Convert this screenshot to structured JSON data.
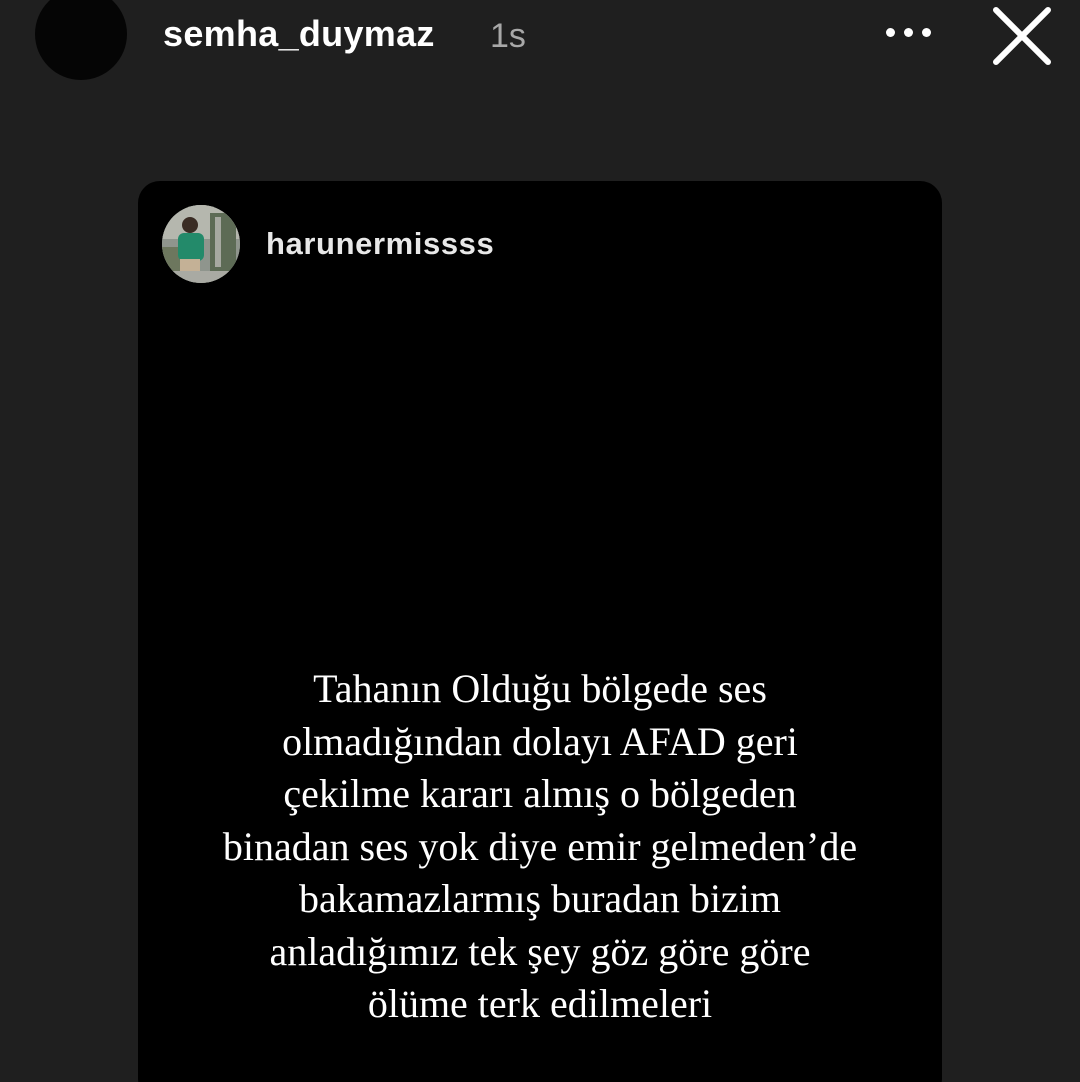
{
  "header": {
    "username": "semha_duymaz",
    "time": "1s",
    "more_icon": "more-horizontal-icon",
    "close_icon": "close-icon"
  },
  "shared_post": {
    "username": "harunermissss",
    "avatar_icon": "profile-photo",
    "text_lines": [
      "Tahanın Olduğu bölgede ses",
      "olmadığından dolayı AFAD geri",
      "çekilme kararı almış o bölgeden",
      "binadan ses yok diye emir gelmeden’de",
      "bakamazlarmış buradan bizim",
      "anladığımız tek şey göz göre göre",
      "ölüme terk edilmeleri"
    ]
  },
  "colors": {
    "background": "#1f1f1f",
    "card": "#000000",
    "text": "#ffffff",
    "muted": "#a8a8a8"
  }
}
